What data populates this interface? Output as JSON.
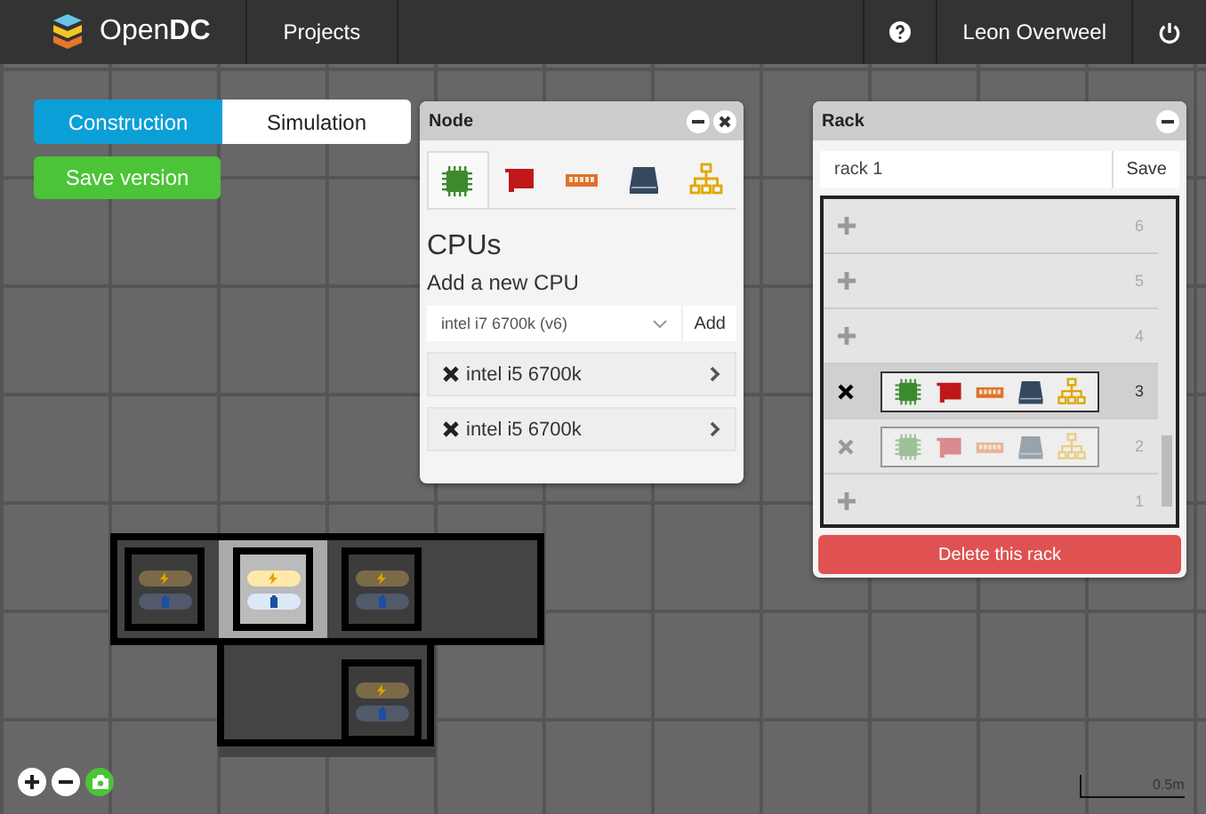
{
  "header": {
    "brand": "Open**DC**",
    "nav": "Projects",
    "user": "Leon Overweel"
  },
  "modes": [
    {
      "label": "Construction",
      "selected": true
    },
    {
      "label": "Simulation",
      "selected": false
    }
  ],
  "save_version": "Save version",
  "node_panel": {
    "title": "Node",
    "tabs": [
      {
        "kind": "cpu",
        "selected": true
      },
      {
        "kind": "gpu",
        "selected": false
      },
      {
        "kind": "memory",
        "selected": false
      },
      {
        "kind": "storage",
        "selected": false
      },
      {
        "kind": "network",
        "selected": false
      }
    ],
    "heading": "CPUs",
    "subheading": "Add a new CPU",
    "select_value": "intel i7 6700k (v6)",
    "add_button": "Add",
    "units": [
      {
        "name": "intel i5 6700k"
      },
      {
        "name": "intel i5 6700k"
      }
    ]
  },
  "rack_panel": {
    "title": "Rack",
    "name_value": "rack 1",
    "save_button": "Save",
    "slots": [
      {
        "number": "6",
        "kind": "empty",
        "selected": false
      },
      {
        "number": "5",
        "kind": "empty",
        "selected": false
      },
      {
        "number": "4",
        "kind": "empty",
        "selected": false
      },
      {
        "number": "3",
        "kind": "machine",
        "selected": true
      },
      {
        "number": "2",
        "kind": "machine",
        "selected": false
      },
      {
        "number": "1",
        "kind": "empty",
        "selected": false
      }
    ],
    "delete_button": "Delete this rack"
  },
  "tiles": [
    {
      "rack": true,
      "selected": false
    },
    {
      "rack": true,
      "selected": true
    },
    {
      "rack": true,
      "selected": false
    },
    {
      "rack": false,
      "selected": false
    },
    {
      "rack": false,
      "selected": false
    },
    {
      "rack": true,
      "selected": false
    }
  ],
  "scale": "0.5m"
}
